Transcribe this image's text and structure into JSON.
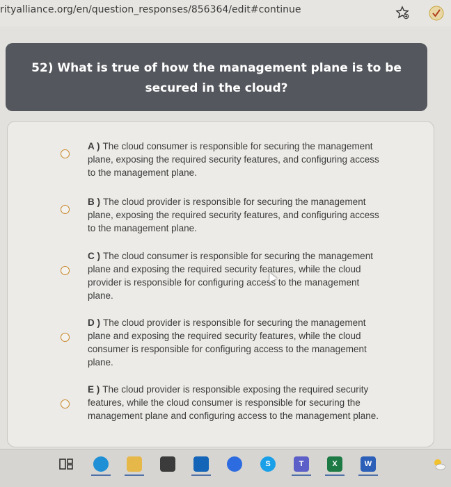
{
  "browser": {
    "url": "rityalliance.org/en/question_responses/856364/edit#continue",
    "icons": [
      "star-add-icon",
      "checkmark-icon"
    ]
  },
  "question": {
    "text": "52) What is true of how the management plane is to be secured in the cloud?"
  },
  "answers": [
    {
      "letter": "A )",
      "text": "The cloud consumer is responsible for securing the management plane, exposing the required security features, and configuring access to the management plane."
    },
    {
      "letter": "B )",
      "text": "The cloud provider is responsible for securing the management plane, exposing the required security features, and configuring access to the management plane."
    },
    {
      "letter": "C )",
      "text": "The cloud consumer is responsible for securing the management plane and exposing the required security features, while the cloud provider is responsible for configuring access to the management plane."
    },
    {
      "letter": "D )",
      "text": "The cloud provider is responsible for securing the management plane and exposing the required security features, while the cloud consumer is responsible for configuring access to the management plane."
    },
    {
      "letter": "E )",
      "text": "The cloud provider is responsible exposing the required security features, while the cloud consumer is responsible for securing the management plane and configuring access to the management plane."
    }
  ],
  "taskbar": {
    "icons": [
      "task-view-icon",
      "edge-icon",
      "file-explorer-icon",
      "store-icon",
      "outlook-icon",
      "zoom-icon",
      "skype-icon",
      "teams-icon",
      "excel-icon",
      "word-icon",
      "weather-icon"
    ],
    "labels": {
      "excel": "X",
      "word": "W",
      "skype": "S",
      "teams": "T"
    },
    "colors": {
      "edge": "#1f8fd6",
      "explorer": "#e6b84a",
      "store": "#3b3b3b",
      "outlook": "#1465b8",
      "zoom": "#2d6be0",
      "skype": "#1aa0e8",
      "teams": "#5b5fc7",
      "excel": "#1e7a45",
      "word": "#2b5fb8"
    }
  }
}
